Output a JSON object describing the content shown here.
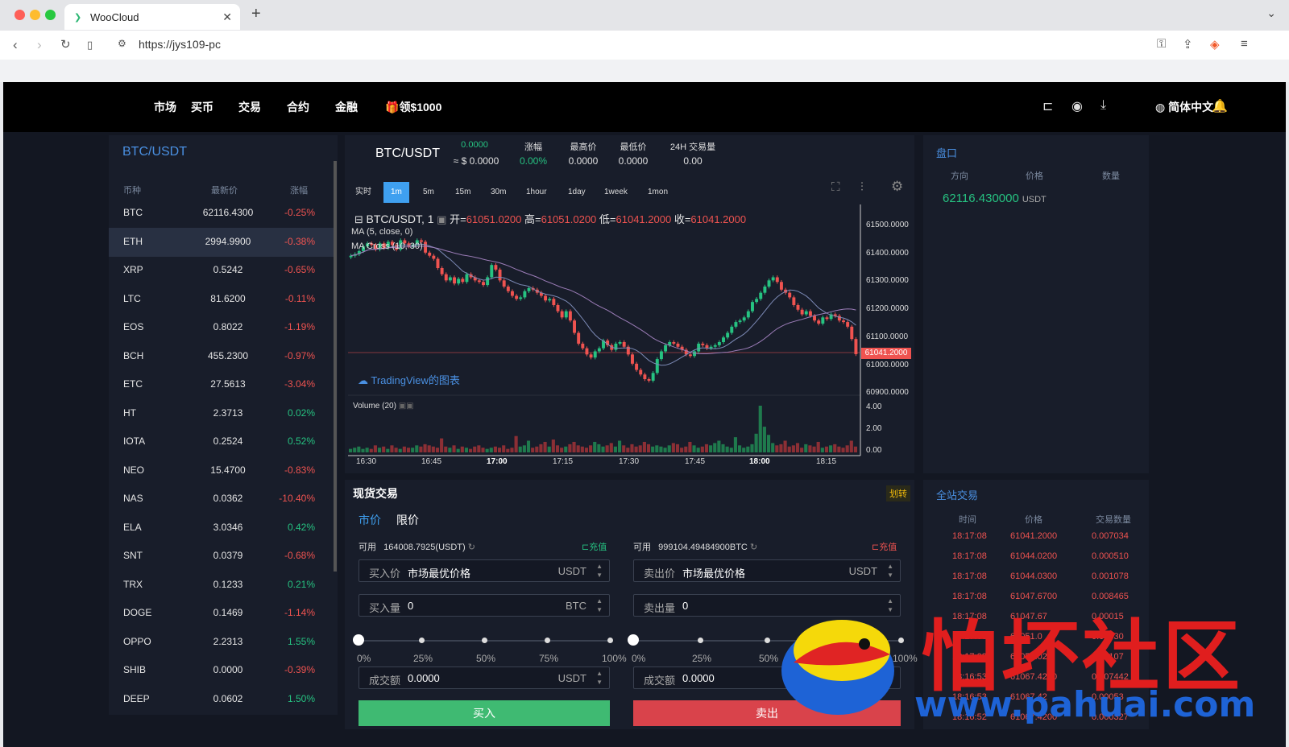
{
  "browser": {
    "tab_title": "WooCloud",
    "url": "https://jys109-pc"
  },
  "nav": {
    "menu": [
      "市场",
      "买币",
      "交易",
      "合约",
      "金融",
      "领$1000"
    ],
    "language": "简体中文"
  },
  "market_list": {
    "title": "BTC/USDT",
    "headers": [
      "币种",
      "最新价",
      "涨幅"
    ],
    "rows": [
      {
        "sym": "BTC",
        "price": "62116.4300",
        "chg": "-0.25%"
      },
      {
        "sym": "ETH",
        "price": "2994.9900",
        "chg": "-0.38%"
      },
      {
        "sym": "XRP",
        "price": "0.5242",
        "chg": "-0.65%"
      },
      {
        "sym": "LTC",
        "price": "81.6200",
        "chg": "-0.11%"
      },
      {
        "sym": "EOS",
        "price": "0.8022",
        "chg": "-1.19%"
      },
      {
        "sym": "BCH",
        "price": "455.2300",
        "chg": "-0.97%"
      },
      {
        "sym": "ETC",
        "price": "27.5613",
        "chg": "-3.04%"
      },
      {
        "sym": "HT",
        "price": "2.3713",
        "chg": "0.02%"
      },
      {
        "sym": "IOTA",
        "price": "0.2524",
        "chg": "0.52%"
      },
      {
        "sym": "NEO",
        "price": "15.4700",
        "chg": "-0.83%"
      },
      {
        "sym": "NAS",
        "price": "0.0362",
        "chg": "-10.40%"
      },
      {
        "sym": "ELA",
        "price": "3.0346",
        "chg": "0.42%"
      },
      {
        "sym": "SNT",
        "price": "0.0379",
        "chg": "-0.68%"
      },
      {
        "sym": "TRX",
        "price": "0.1233",
        "chg": "0.21%"
      },
      {
        "sym": "DOGE",
        "price": "0.1469",
        "chg": "-1.14%"
      },
      {
        "sym": "OPPO",
        "price": "2.2313",
        "chg": "1.55%"
      },
      {
        "sym": "SHIB",
        "price": "0.0000",
        "chg": "-0.39%"
      },
      {
        "sym": "DEEP",
        "price": "0.0602",
        "chg": "1.50%"
      }
    ]
  },
  "ticker": {
    "symbol": "BTC/USDT",
    "price": "0.0000",
    "price_usd": "≈ $ 0.0000",
    "stats": [
      {
        "label": "涨幅",
        "value": "0.00%"
      },
      {
        "label": "最高价",
        "value": "0.0000"
      },
      {
        "label": "最低价",
        "value": "0.0000"
      },
      {
        "label": "24H 交易量",
        "value": "0.00"
      }
    ]
  },
  "timeframes": [
    "实时",
    "1m",
    "5m",
    "15m",
    "30m",
    "1hour",
    "1day",
    "1week",
    "1mon"
  ],
  "chart": {
    "legend": "BTC/USDT, 1",
    "open_label": "开=",
    "open": "61051.0200",
    "high_label": "高=",
    "high": "61051.0200",
    "low_label": "低=",
    "low": "61041.2000",
    "close_label": "收=",
    "close": "61041.2000",
    "ma1": "MA (5, close, 0)",
    "ma2": "MA Cross (10, 30)",
    "last_price": "61041.2000",
    "yticks": [
      "61500.0000",
      "61400.0000",
      "61300.0000",
      "61200.0000",
      "61100.0000",
      "61000.0000",
      "60900.0000"
    ],
    "vol_label": "Volume (20)",
    "vol_ticks": [
      "4.00",
      "2.00",
      "0.00"
    ],
    "xticks": [
      "16:30",
      "16:45",
      "17:00",
      "17:15",
      "17:30",
      "17:45",
      "18:00",
      "18:15"
    ],
    "watermark": "TradingView的图表",
    "closes": [
      61360,
      61365,
      61375,
      61390,
      61400,
      61395,
      61380,
      61400,
      61385,
      61405,
      61395,
      61380,
      61410,
      61400,
      61390,
      61395,
      61410,
      61405,
      61370,
      61360,
      61350,
      61320,
      61300,
      61280,
      61290,
      61270,
      61285,
      61275,
      61300,
      61290,
      61280,
      61275,
      61265,
      61290,
      61330,
      61315,
      61280,
      61260,
      61245,
      61230,
      61220,
      61225,
      61245,
      61255,
      61250,
      61240,
      61230,
      61215,
      61220,
      61200,
      61180,
      61160,
      61180,
      61150,
      61110,
      61075,
      61060,
      61040,
      61030,
      61050,
      61060,
      61085,
      61070,
      61055,
      61075,
      61080,
      61065,
      61040,
      61010,
      60990,
      60975,
      60960,
      60955,
      60980,
      61025,
      61050,
      61070,
      61080,
      61075,
      61065,
      61055,
      61040,
      61035,
      61050,
      61075,
      61070,
      61060,
      61065,
      61070,
      61080,
      61095,
      61110,
      61130,
      61145,
      61150,
      61160,
      61180,
      61210,
      61220,
      61240,
      61260,
      61280,
      61290,
      61275,
      61250,
      61240,
      61225,
      61200,
      61185,
      61170,
      61180,
      61165,
      61150,
      61140,
      61160,
      61155,
      61170,
      61165,
      61150,
      61145,
      61130,
      61090,
      61041
    ],
    "volumes": [
      0.3,
      0.4,
      0.5,
      0.3,
      0.4,
      0.3,
      0.6,
      0.4,
      0.5,
      0.3,
      0.6,
      0.4,
      0.3,
      0.5,
      0.4,
      0.4,
      0.6,
      0.5,
      0.7,
      0.6,
      0.5,
      0.4,
      1.2,
      0.5,
      0.4,
      0.6,
      0.3,
      0.5,
      0.4,
      0.3,
      0.5,
      0.6,
      0.4,
      0.3,
      0.4,
      0.5,
      0.4,
      0.6,
      0.3,
      0.4,
      1.4,
      0.5,
      0.6,
      1.0,
      0.4,
      0.5,
      0.7,
      0.9,
      0.5,
      1.1,
      0.6,
      0.4,
      0.5,
      0.7,
      0.9,
      0.6,
      0.5,
      0.4,
      0.6,
      0.9,
      0.7,
      0.5,
      0.6,
      0.8,
      0.5,
      1.0,
      0.6,
      0.4,
      0.7,
      0.5,
      0.6,
      0.9,
      0.7,
      0.5,
      0.6,
      0.5,
      0.4,
      0.6,
      0.8,
      0.7,
      0.4,
      0.5,
      0.9,
      0.6,
      0.4,
      0.5,
      0.7,
      0.6,
      0.8,
      1.0,
      0.7,
      0.5,
      0.4,
      1.3,
      0.6,
      0.4,
      0.5,
      0.7,
      1.6,
      4.0,
      2.2,
      1.5,
      0.8,
      0.6,
      0.7,
      1.0,
      0.5,
      0.6,
      0.8,
      0.4,
      0.7,
      0.6,
      0.5,
      0.9,
      0.4,
      0.5,
      0.6,
      0.7,
      0.5,
      0.4,
      0.6,
      1.0,
      0.5
    ]
  },
  "spot": {
    "title": "现货交易",
    "transfer": "划转",
    "tab_market": "市价",
    "tab_limit": "限价",
    "buy": {
      "avail_label": "可用",
      "avail": "164008.7925(USDT)",
      "charge": "充值",
      "price_label": "买入价",
      "price_val": "市场最优价格",
      "price_unit": "USDT",
      "qty_label": "买入量",
      "qty_val": "0",
      "qty_unit": "BTC",
      "amt_label": "成交额",
      "amt_val": "0.0000",
      "amt_unit": "USDT",
      "button": "买入"
    },
    "sell": {
      "avail_label": "可用",
      "avail": "999104.49484900BTC",
      "charge": "充值",
      "price_label": "卖出价",
      "price_val": "市场最优价格",
      "price_unit": "USDT",
      "qty_label": "卖出量",
      "qty_val": "0",
      "amt_label": "成交额",
      "amt_val": "0.0000",
      "button": "卖出"
    },
    "buy_pct": [
      "0%",
      "25%",
      "50%",
      "75%",
      "100%"
    ],
    "sell_pct": [
      "0%",
      "25%",
      "50%",
      "75%",
      "100%"
    ]
  },
  "orderbook": {
    "title": "盘口",
    "headers": [
      "方向",
      "价格",
      "数量"
    ],
    "price": "62116.430000",
    "unit": "USDT"
  },
  "trades": {
    "title": "全站交易",
    "headers": [
      "时间",
      "价格",
      "交易数量"
    ],
    "rows": [
      {
        "t": "18:17:08",
        "p": "61041.2000",
        "q": "0.007034"
      },
      {
        "t": "18:17:08",
        "p": "61044.0200",
        "q": "0.000510"
      },
      {
        "t": "18:17:08",
        "p": "61044.0300",
        "q": "0.001078"
      },
      {
        "t": "18:17:08",
        "p": "61047.6700",
        "q": "0.008465"
      },
      {
        "t": "18:17:08",
        "p": "61047.67",
        "q": "0.00015"
      },
      {
        "t": "18:17:08",
        "p": "61051.0",
        "q": "0.00830"
      },
      {
        "t": "18:17:08",
        "p": "61051.02",
        "q": "0.00107"
      },
      {
        "t": "18:16:53",
        "p": "61067.4200",
        "q": "0.007442"
      },
      {
        "t": "18:16:53",
        "p": "61067.42",
        "q": "0.00053"
      },
      {
        "t": "18:16:52",
        "p": "61067.4200",
        "q": "0.000327"
      }
    ]
  },
  "watermark": {
    "cn": "怕坏社区",
    "url": "www.pahuai.com"
  },
  "colors": {
    "up": "#26c281",
    "down": "#ef5350",
    "accent": "#3fa0f0"
  }
}
